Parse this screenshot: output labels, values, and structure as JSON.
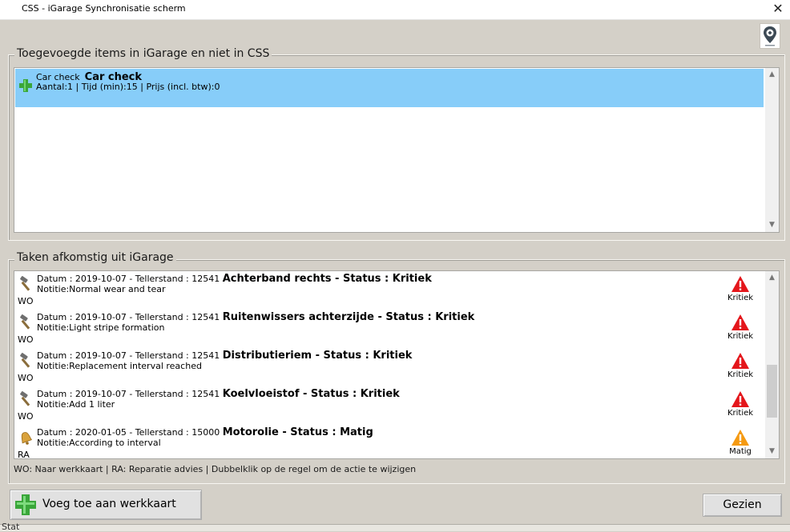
{
  "window": {
    "title": "CSS - iGarage Synchronisatie scherm",
    "close_glyph": "✕"
  },
  "top_icon": "location-pin-logo-icon",
  "added_panel": {
    "legend": "Toegevoegde items in iGarage en niet in CSS",
    "items": [
      {
        "icon": "plus-icon",
        "code": "Car check",
        "name": "Car check",
        "details": "Aantal:1 | Tijd (min):15 | Prijs (incl. btw):0"
      }
    ]
  },
  "tasks_panel": {
    "legend": "Taken afkomstig uit iGarage",
    "items": [
      {
        "icon": "hammer-icon",
        "meta": "Datum : 2019-10-07 -  Tellerstand : 12541 ",
        "title": "Achterband rechts - Status : Kritiek",
        "note": "Notitie:Normal wear and tear",
        "type": "WO",
        "status": "Kritiek",
        "status_color": "#e4161b"
      },
      {
        "icon": "hammer-icon",
        "meta": "Datum : 2019-10-07 -  Tellerstand : 12541 ",
        "title": "Ruitenwissers achterzijde - Status : Kritiek",
        "note": "Notitie:Light stripe formation",
        "type": "WO",
        "status": "Kritiek",
        "status_color": "#e4161b"
      },
      {
        "icon": "hammer-icon",
        "meta": "Datum : 2019-10-07 -  Tellerstand : 12541 ",
        "title": "Distributieriem - Status : Kritiek",
        "note": "Notitie:Replacement interval reached",
        "type": "WO",
        "status": "Kritiek",
        "status_color": "#e4161b"
      },
      {
        "icon": "hammer-icon",
        "meta": "Datum : 2019-10-07 -  Tellerstand : 12541 ",
        "title": "Koelvloeistof - Status : Kritiek",
        "note": "Notitie:Add 1 liter",
        "type": "WO",
        "status": "Kritiek",
        "status_color": "#e4161b"
      },
      {
        "icon": "bell-icon",
        "meta": "Datum : 2020-01-05 -  Tellerstand : 15000 ",
        "title": "Motorolie - Status : Matig",
        "note": "Notitie:According to interval",
        "type": "RA",
        "status": "Matig",
        "status_color": "#f59a12"
      }
    ],
    "footer_legend": "WO: Naar werkkaart | RA: Reparatie advies | Dubbelklik op de regel om de actie te wijzigen"
  },
  "buttons": {
    "add_label": "Voeg toe aan werkkaart",
    "add_icon": "plus-icon",
    "seen_label": "Gezien"
  },
  "status_bar": {
    "text": "Stat"
  }
}
